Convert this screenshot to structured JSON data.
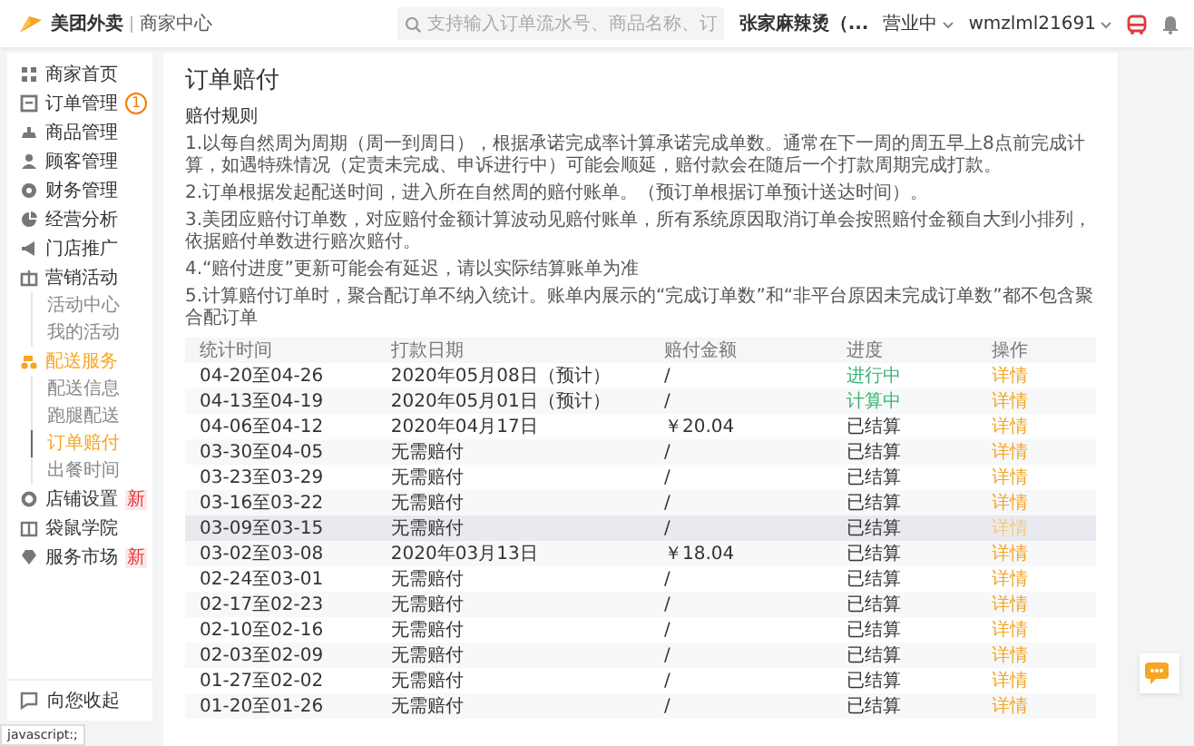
{
  "header": {
    "brand": "美团外卖",
    "brand_sub": "商家中心",
    "search": {
      "placeholder": "支持输入订单流水号、商品名称、订"
    },
    "store": "张家麻辣烫（...",
    "status": "营业中",
    "account": "wmzlml21691"
  },
  "sidebar": {
    "items": [
      {
        "label": "商家首页",
        "selected": false
      },
      {
        "label": "订单管理",
        "selected": false,
        "badge": {
          "text": "1",
          "kind": "count"
        }
      },
      {
        "label": "商品管理",
        "selected": false
      },
      {
        "label": "顾客管理",
        "selected": false
      },
      {
        "label": "财务管理",
        "selected": false
      },
      {
        "label": "经营分析",
        "selected": false
      },
      {
        "label": "门店推广",
        "selected": false
      },
      {
        "label": "营销活动",
        "selected": false,
        "expanded": true,
        "children": [
          {
            "label": "活动中心",
            "selected": false
          },
          {
            "label": "我的活动",
            "selected": false
          }
        ]
      },
      {
        "label": "配送服务",
        "selected": true,
        "expanded": true,
        "children": [
          {
            "label": "配送信息",
            "selected": false
          },
          {
            "label": "跑腿配送",
            "selected": false
          },
          {
            "label": "订单赔付",
            "selected": true
          },
          {
            "label": "出餐时间",
            "selected": false
          }
        ]
      },
      {
        "label": "店铺设置",
        "selected": false,
        "badge": {
          "text": "新",
          "kind": "new"
        }
      },
      {
        "label": "袋鼠学院",
        "selected": false
      },
      {
        "label": "服务市场",
        "selected": false,
        "badge": {
          "text": "新",
          "kind": "new"
        }
      }
    ],
    "footer": "向您收起"
  },
  "page": {
    "title": "订单赔付",
    "rules_title": "赔付规则",
    "rules": [
      "1.以每自然周为周期（周一到周日），根据承诺完成率计算承诺完成单数。通常在下一周的周五早上8点前完成计算，如遇特殊情况（定责未完成、申诉进行中）可能会顺延，赔付款会在随后一个打款周期完成打款。",
      "2.订单根据发起配送时间，进入所在自然周的赔付账单。（预订单根据订单预计送达时间）。",
      "3.美团应赔付订单数，对应赔付金额计算波动见赔付账单，所有系统原因取消订单会按照赔付金额自大到小排列，依据赔付单数进行赔次赔付。",
      "4.“赔付进度”更新可能会有延迟，请以实际结算账单为准",
      "5.计算赔付订单时，聚合配订单不纳入统计。账单内展示的“完成订单数”和“非平台原因未完成订单数”都不包含聚合配订单"
    ]
  },
  "table": {
    "columns": [
      "统计时间",
      "打款日期",
      "赔付金额",
      "进度",
      "操作"
    ],
    "rows": [
      {
        "period": "04-20至04-26",
        "pay_date": "2020年05月08日（预计）",
        "amount": "/",
        "progress": {
          "text": "进行中",
          "color": "#3cb371"
        },
        "action": "详情",
        "hovered": false
      },
      {
        "period": "04-13至04-19",
        "pay_date": "2020年05月01日（预计）",
        "amount": "/",
        "progress": {
          "text": "计算中",
          "color": "#3cb371"
        },
        "action": "详情",
        "hovered": false
      },
      {
        "period": "04-06至04-12",
        "pay_date": "2020年04月17日",
        "amount": "￥20.04",
        "progress": {
          "text": "已结算",
          "color": "#333333"
        },
        "action": "详情",
        "hovered": false
      },
      {
        "period": "03-30至04-05",
        "pay_date": "无需赔付",
        "amount": "/",
        "progress": {
          "text": "已结算",
          "color": "#333333"
        },
        "action": "详情",
        "hovered": false
      },
      {
        "period": "03-23至03-29",
        "pay_date": "无需赔付",
        "amount": "/",
        "progress": {
          "text": "已结算",
          "color": "#333333"
        },
        "action": "详情",
        "hovered": false
      },
      {
        "period": "03-16至03-22",
        "pay_date": "无需赔付",
        "amount": "/",
        "progress": {
          "text": "已结算",
          "color": "#333333"
        },
        "action": "详情",
        "hovered": false
      },
      {
        "period": "03-09至03-15",
        "pay_date": "无需赔付",
        "amount": "/",
        "progress": {
          "text": "已结算",
          "color": "#333333"
        },
        "action": "详情",
        "hovered": true
      },
      {
        "period": "03-02至03-08",
        "pay_date": "2020年03月13日",
        "amount": "￥18.04",
        "progress": {
          "text": "已结算",
          "color": "#333333"
        },
        "action": "详情",
        "hovered": false
      },
      {
        "period": "02-24至03-01",
        "pay_date": "无需赔付",
        "amount": "/",
        "progress": {
          "text": "已结算",
          "color": "#333333"
        },
        "action": "详情",
        "hovered": false
      },
      {
        "period": "02-17至02-23",
        "pay_date": "无需赔付",
        "amount": "/",
        "progress": {
          "text": "已结算",
          "color": "#333333"
        },
        "action": "详情",
        "hovered": false
      },
      {
        "period": "02-10至02-16",
        "pay_date": "无需赔付",
        "amount": "/",
        "progress": {
          "text": "已结算",
          "color": "#333333"
        },
        "action": "详情",
        "hovered": false
      },
      {
        "period": "02-03至02-09",
        "pay_date": "无需赔付",
        "amount": "/",
        "progress": {
          "text": "已结算",
          "color": "#333333"
        },
        "action": "详情",
        "hovered": false
      },
      {
        "period": "01-27至02-02",
        "pay_date": "无需赔付",
        "amount": "/",
        "progress": {
          "text": "已结算",
          "color": "#333333"
        },
        "action": "详情",
        "hovered": false
      },
      {
        "period": "01-20至01-26",
        "pay_date": "无需赔付",
        "amount": "/",
        "progress": {
          "text": "已结算",
          "color": "#333333"
        },
        "action": "详情",
        "hovered": false
      }
    ]
  },
  "status_bar": "javascript:;"
}
